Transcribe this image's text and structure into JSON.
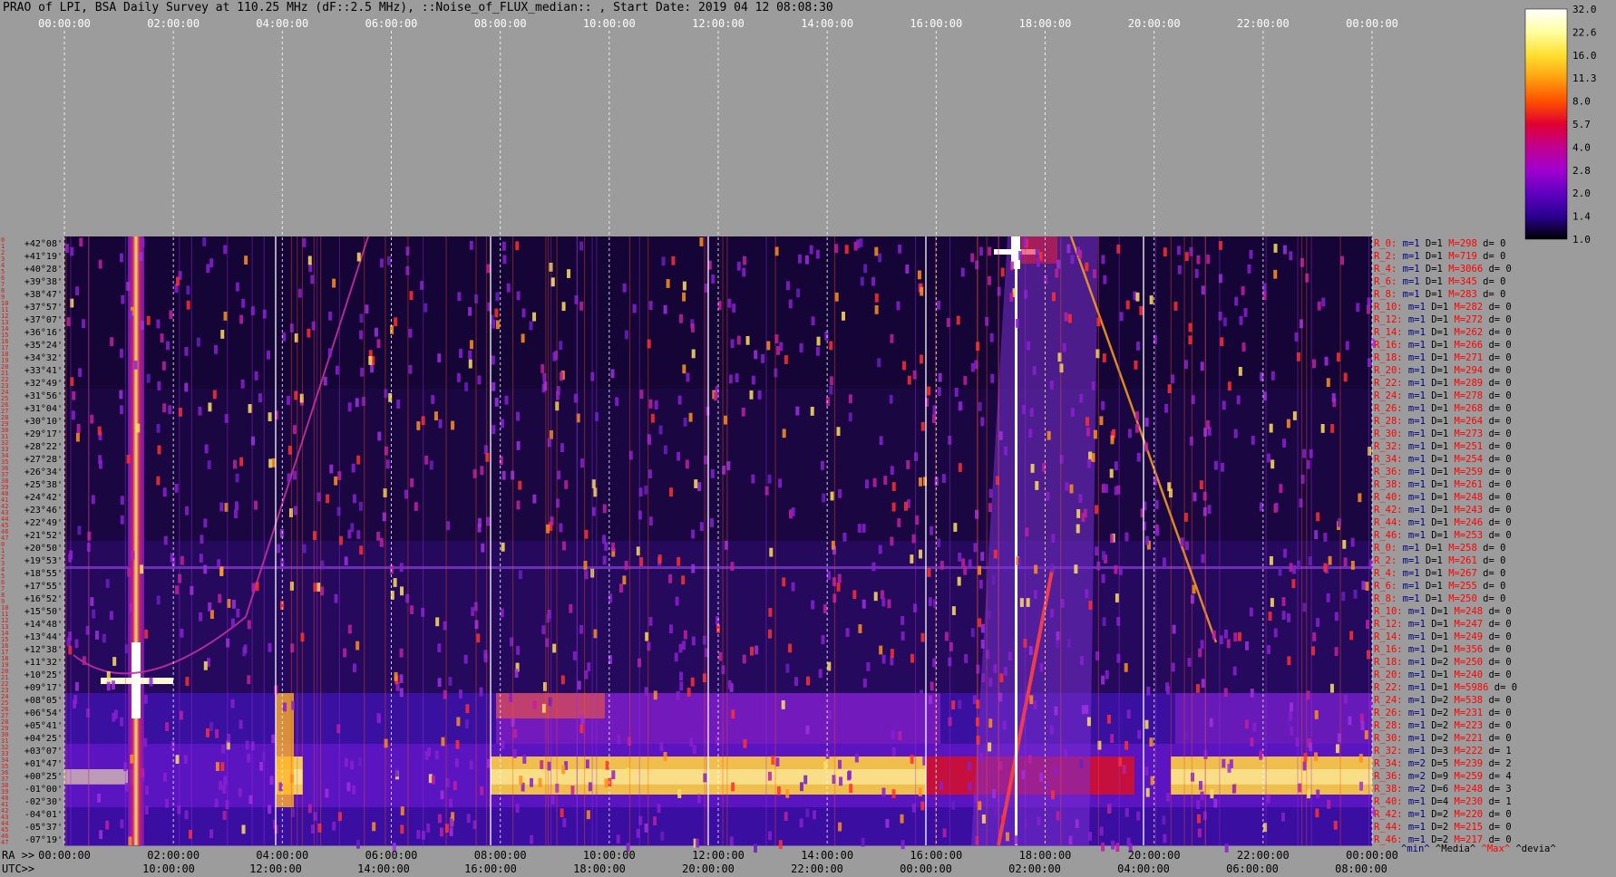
{
  "title": "PRAO of LPI, BSA Daily Survey at 110.25 MHz (dF::2.5 MHz), ::Noise_of_FLUX_median:: , Start Date: 2019 04 12 08:08:30",
  "top_axis": [
    "00:00:00",
    "02:00:00",
    "04:00:00",
    "06:00:00",
    "08:00:00",
    "10:00:00",
    "12:00:00",
    "14:00:00",
    "16:00:00",
    "18:00:00",
    "20:00:00",
    "22:00:00",
    "00:00:00"
  ],
  "ra_label": "RA >>",
  "ra_axis": [
    "00:00:00",
    "02:00:00",
    "04:00:00",
    "06:00:00",
    "08:00:00",
    "10:00:00",
    "12:00:00",
    "14:00:00",
    "16:00:00",
    "18:00:00",
    "20:00:00",
    "22:00:00",
    "00:00:00"
  ],
  "utc_label": "UTC>>",
  "utc_axis": [
    "10:00:00",
    "12:00:00",
    "14:00:00",
    "16:00:00",
    "18:00:00",
    "20:00:00",
    "22:00:00",
    "00:00:00",
    "02:00:00",
    "04:00:00",
    "06:00:00",
    "08:00:00"
  ],
  "colorbar": {
    "ticks": [
      "32.0",
      "22.6",
      "16.0",
      "11.3",
      "8.0",
      "5.7",
      "4.0",
      "2.8",
      "2.0",
      "1.4",
      "1.0"
    ],
    "stops": [
      "#ffffff",
      "#ffffa0",
      "#ffe030",
      "#ffa010",
      "#ff5000",
      "#e00030",
      "#c00090",
      "#a000d0",
      "#6000c0",
      "#2a0090",
      "#000000"
    ]
  },
  "stat_legend": [
    {
      "text": "^min^",
      "color": "#000080"
    },
    {
      "text": "^Media^",
      "color": "#000000"
    },
    {
      "text": "^Max^",
      "color": "#ff0000"
    },
    {
      "text": "^devia^",
      "color": "#000000"
    }
  ],
  "row_numbers": [
    "0",
    "1",
    "2",
    "3",
    "4",
    "5",
    "6",
    "7",
    "8",
    "9",
    "10",
    "11",
    "12",
    "13",
    "14",
    "15",
    "16",
    "17",
    "18",
    "19",
    "20",
    "21",
    "22",
    "23",
    "24",
    "25",
    "26",
    "27",
    "28",
    "29",
    "30",
    "31",
    "32",
    "33",
    "34",
    "35",
    "36",
    "37",
    "38",
    "39",
    "40",
    "41",
    "42",
    "43",
    "44",
    "45",
    "46",
    "47",
    "0",
    "1",
    "2",
    "3",
    "4",
    "5",
    "6",
    "7",
    "8",
    "9",
    "10",
    "11",
    "12",
    "13",
    "14",
    "15",
    "16",
    "17",
    "18",
    "19",
    "20",
    "21",
    "22",
    "23",
    "24",
    "25",
    "26",
    "27",
    "28",
    "29",
    "30",
    "31",
    "32",
    "33",
    "34",
    "35",
    "36",
    "37",
    "38",
    "39",
    "40",
    "41",
    "42",
    "43",
    "44",
    "45",
    "46",
    "47"
  ],
  "chart_data": {
    "type": "heatmap",
    "title": "PRAO of LPI, BSA Daily Survey at 110.25 MHz (dF::2.5 MHz), ::Noise_of_FLUX_median:: , Start Date: 2019 04 12 08:08:30",
    "x_axis": "RA 00:00:00 - 24:00:00 (top and RA>> rows), UTC 08:08:30 start",
    "color_scale": "logarithmic 1.0 - 32.0",
    "declinations": [
      "+42°08'",
      "+41°19'",
      "+40°28'",
      "+39°38'",
      "+38°47'",
      "+37°57'",
      "+37°07'",
      "+36°16'",
      "+35°24'",
      "+34°32'",
      "+33°41'",
      "+32°49'",
      "+31°56'",
      "+31°04'",
      "+30°10'",
      "+29°17'",
      "+28°22'",
      "+27°28'",
      "+26°34'",
      "+25°38'",
      "+24°42'",
      "+23°46'",
      "+22°49'",
      "+21°52'",
      "+20°50'",
      "+19°53'",
      "+18°55'",
      "+17°55'",
      "+16°52'",
      "+15°50'",
      "+14°48'",
      "+13°44'",
      "+12°38'",
      "+11°32'",
      "+10°25'",
      "+09°17'",
      "+08°05'",
      "+06°54'",
      "+05°41'",
      "+04°25'",
      "+03°07'",
      "+01°47'",
      "+00°25'",
      "-01°00'",
      "-02°30'",
      "-04°01'",
      "-05°37'",
      "-07°19'"
    ],
    "row_stats": [
      {
        "r": "R_0:",
        "min": "m=1",
        "d": "D=1",
        "max": "M=298",
        "dev": "d= 0"
      },
      {
        "r": "R_2:",
        "min": "m=1",
        "d": "D=1",
        "max": "M=719",
        "dev": "d= 0"
      },
      {
        "r": "R_4:",
        "min": "m=1",
        "d": "D=1",
        "max": "M=3066",
        "dev": "d= 0"
      },
      {
        "r": "R_6:",
        "min": "m=1",
        "d": "D=1",
        "max": "M=345",
        "dev": "d= 0"
      },
      {
        "r": "R_8:",
        "min": "m=1",
        "d": "D=1",
        "max": "M=283",
        "dev": "d= 0"
      },
      {
        "r": "R_10:",
        "min": "m=1",
        "d": "D=1",
        "max": "M=282",
        "dev": "d= 0"
      },
      {
        "r": "R_12:",
        "min": "m=1",
        "d": "D=1",
        "max": "M=272",
        "dev": "d= 0"
      },
      {
        "r": "R_14:",
        "min": "m=1",
        "d": "D=1",
        "max": "M=262",
        "dev": "d= 0"
      },
      {
        "r": "R_16:",
        "min": "m=1",
        "d": "D=1",
        "max": "M=266",
        "dev": "d= 0"
      },
      {
        "r": "R_18:",
        "min": "m=1",
        "d": "D=1",
        "max": "M=271",
        "dev": "d= 0"
      },
      {
        "r": "R_20:",
        "min": "m=1",
        "d": "D=1",
        "max": "M=294",
        "dev": "d= 0"
      },
      {
        "r": "R_22:",
        "min": "m=1",
        "d": "D=1",
        "max": "M=289",
        "dev": "d= 0"
      },
      {
        "r": "R_24:",
        "min": "m=1",
        "d": "D=1",
        "max": "M=278",
        "dev": "d= 0"
      },
      {
        "r": "R_26:",
        "min": "m=1",
        "d": "D=1",
        "max": "M=268",
        "dev": "d= 0"
      },
      {
        "r": "R_28:",
        "min": "m=1",
        "d": "D=1",
        "max": "M=264",
        "dev": "d= 0"
      },
      {
        "r": "R_30:",
        "min": "m=1",
        "d": "D=1",
        "max": "M=273",
        "dev": "d= 0"
      },
      {
        "r": "R_32:",
        "min": "m=1",
        "d": "D=1",
        "max": "M=251",
        "dev": "d= 0"
      },
      {
        "r": "R_34:",
        "min": "m=1",
        "d": "D=1",
        "max": "M=254",
        "dev": "d= 0"
      },
      {
        "r": "R_36:",
        "min": "m=1",
        "d": "D=1",
        "max": "M=259",
        "dev": "d= 0"
      },
      {
        "r": "R_38:",
        "min": "m=1",
        "d": "D=1",
        "max": "M=261",
        "dev": "d= 0"
      },
      {
        "r": "R_40:",
        "min": "m=1",
        "d": "D=1",
        "max": "M=248",
        "dev": "d= 0"
      },
      {
        "r": "R_42:",
        "min": "m=1",
        "d": "D=1",
        "max": "M=243",
        "dev": "d= 0"
      },
      {
        "r": "R_44:",
        "min": "m=1",
        "d": "D=1",
        "max": "M=246",
        "dev": "d= 0"
      },
      {
        "r": "R_46:",
        "min": "m=1",
        "d": "D=1",
        "max": "M=253",
        "dev": "d= 0"
      },
      {
        "r": "R_0:",
        "min": "m=1",
        "d": "D=1",
        "max": "M=258",
        "dev": "d= 0"
      },
      {
        "r": "R_2:",
        "min": "m=1",
        "d": "D=1",
        "max": "M=261",
        "dev": "d= 0"
      },
      {
        "r": "R_4:",
        "min": "m=1",
        "d": "D=1",
        "max": "M=267",
        "dev": "d= 0"
      },
      {
        "r": "R_6:",
        "min": "m=1",
        "d": "D=1",
        "max": "M=255",
        "dev": "d= 0"
      },
      {
        "r": "R_8:",
        "min": "m=1",
        "d": "D=1",
        "max": "M=250",
        "dev": "d= 0"
      },
      {
        "r": "R_10:",
        "min": "m=1",
        "d": "D=1",
        "max": "M=248",
        "dev": "d= 0"
      },
      {
        "r": "R_12:",
        "min": "m=1",
        "d": "D=1",
        "max": "M=247",
        "dev": "d= 0"
      },
      {
        "r": "R_14:",
        "min": "m=1",
        "d": "D=1",
        "max": "M=249",
        "dev": "d= 0"
      },
      {
        "r": "R_16:",
        "min": "m=1",
        "d": "D=1",
        "max": "M=356",
        "dev": "d= 0"
      },
      {
        "r": "R_18:",
        "min": "m=1",
        "d": "D=2",
        "max": "M=250",
        "dev": "d= 0"
      },
      {
        "r": "R_20:",
        "min": "m=1",
        "d": "D=1",
        "max": "M=240",
        "dev": "d= 0"
      },
      {
        "r": "R_22:",
        "min": "m=1",
        "d": "D=1",
        "max": "M=5986",
        "dev": "d= 0"
      },
      {
        "r": "R_24:",
        "min": "m=1",
        "d": "D=2",
        "max": "M=538",
        "dev": "d= 0"
      },
      {
        "r": "R_26:",
        "min": "m=1",
        "d": "D=2",
        "max": "M=231",
        "dev": "d= 0"
      },
      {
        "r": "R_28:",
        "min": "m=1",
        "d": "D=2",
        "max": "M=223",
        "dev": "d= 0"
      },
      {
        "r": "R_30:",
        "min": "m=1",
        "d": "D=2",
        "max": "M=221",
        "dev": "d= 0"
      },
      {
        "r": "R_32:",
        "min": "m=1",
        "d": "D=3",
        "max": "M=222",
        "dev": "d= 1"
      },
      {
        "r": "R_34:",
        "min": "m=2",
        "d": "D=5",
        "max": "M=239",
        "dev": "d= 2"
      },
      {
        "r": "R_36:",
        "min": "m=2",
        "d": "D=9",
        "max": "M=259",
        "dev": "d= 4"
      },
      {
        "r": "R_38:",
        "min": "m=2",
        "d": "D=6",
        "max": "M=248",
        "dev": "d= 3"
      },
      {
        "r": "R_40:",
        "min": "m=1",
        "d": "D=4",
        "max": "M=230",
        "dev": "d= 1"
      },
      {
        "r": "R_42:",
        "min": "m=1",
        "d": "D=2",
        "max": "M=220",
        "dev": "d= 0"
      },
      {
        "r": "R_44:",
        "min": "m=1",
        "d": "D=2",
        "max": "M=215",
        "dev": "d= 0"
      },
      {
        "r": "R_46:",
        "min": "m=1",
        "d": "D=2",
        "max": "M=217",
        "dev": "d= 0"
      }
    ]
  }
}
